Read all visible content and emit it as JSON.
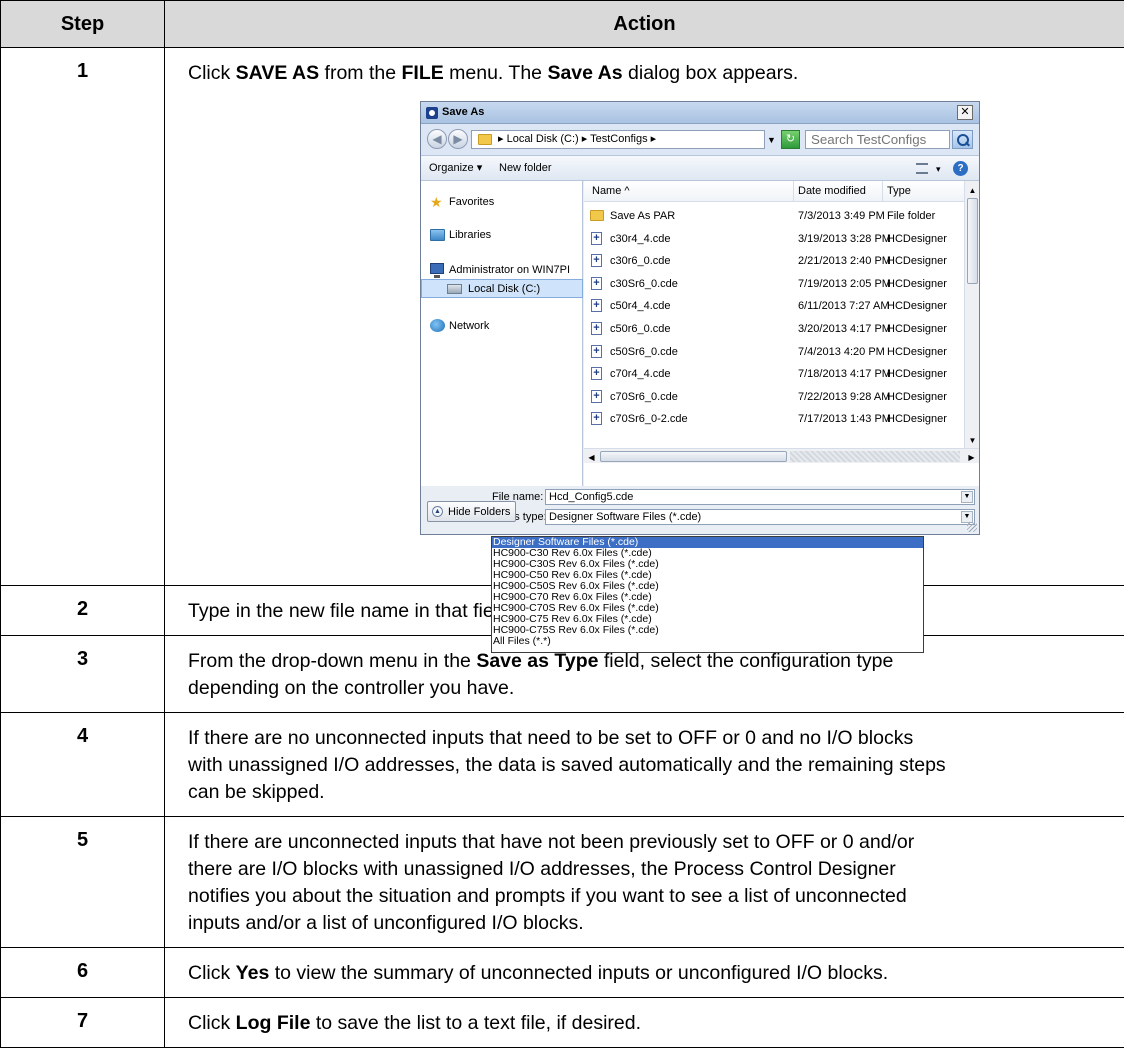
{
  "table": {
    "header_step": "Step",
    "header_action": "Action",
    "steps": [
      {
        "num": "1",
        "parts": [
          {
            "t": "Click "
          },
          {
            "t": "SAVE AS",
            "b": true
          },
          {
            "t": " from the "
          },
          {
            "t": "FILE",
            "b": true
          },
          {
            "t": " menu. The "
          },
          {
            "t": "Save As",
            "b": true
          },
          {
            "t": " dialog box appears."
          }
        ]
      },
      {
        "num": "2",
        "parts": [
          {
            "t": "Type in the new file name in that field."
          }
        ]
      },
      {
        "num": "3",
        "parts": [
          {
            "t": "From the drop-down menu in the "
          },
          {
            "t": "Save as Type",
            "b": true
          },
          {
            "t": " field, select the configuration type"
          },
          {
            "br": true
          },
          {
            "t": "depending on the controller you have."
          }
        ]
      },
      {
        "num": "4",
        "parts": [
          {
            "t": "If there are no unconnected inputs that need to be set to OFF or 0 and no I/O blocks"
          },
          {
            "br": true
          },
          {
            "t": "with unassigned I/O addresses, the data is saved automatically and the remaining steps"
          },
          {
            "br": true
          },
          {
            "t": "can be skipped."
          }
        ]
      },
      {
        "num": "5",
        "parts": [
          {
            "t": "If there are unconnected inputs that have not been previously set to OFF or 0 and/or"
          },
          {
            "br": true
          },
          {
            "t": "there are I/O blocks with unassigned I/O addresses, the Process Control Designer"
          },
          {
            "br": true
          },
          {
            "t": "notifies you about the situation and prompts if you want to see a list of unconnected"
          },
          {
            "br": true
          },
          {
            "t": "inputs and/or a list of unconfigured I/O blocks."
          }
        ]
      },
      {
        "num": "6",
        "parts": [
          {
            "t": "Click "
          },
          {
            "t": "Yes",
            "b": true
          },
          {
            "t": " to view the summary of unconnected inputs or unconfigured I/O blocks."
          }
        ]
      },
      {
        "num": "7",
        "parts": [
          {
            "t": "Click "
          },
          {
            "t": "Log File",
            "b": true
          },
          {
            "t": " to save the list to a text file, if desired."
          }
        ]
      }
    ]
  },
  "dialog": {
    "title": "Save As",
    "close_glyph": "✕",
    "back_glyph": "◀",
    "forward_glyph": "▶",
    "address_path": "▸ Local Disk (C:) ▸ TestConfigs ▸",
    "address_dropdown_glyph": "▼",
    "refresh_glyph": "↻",
    "search_placeholder": "Search TestConfigs",
    "organize_label": "Organize ▾",
    "new_folder_label": "New folder",
    "view_dropdown_glyph": "▾",
    "help_glyph": "?",
    "nav_items": [
      {
        "label": "Favorites",
        "icon": "star-icon"
      },
      {
        "label": "Libraries",
        "icon": "libraries-icon"
      },
      {
        "label": "Administrator on WIN7PI",
        "icon": "computer-icon"
      },
      {
        "label": "Local Disk (C:)",
        "icon": "local-disk-icon"
      },
      {
        "label": "Network",
        "icon": "network-icon"
      }
    ],
    "columns": {
      "name": "Name ^",
      "date": "Date modified",
      "type": "Type"
    },
    "files": [
      {
        "name": "Save As PAR",
        "date": "7/3/2013 3:49 PM",
        "type": "File folder",
        "icon": "folder-icon"
      },
      {
        "name": "c30r4_4.cde",
        "date": "3/19/2013 3:28 PM",
        "type": "HCDesigner",
        "icon": "cde-file-icon"
      },
      {
        "name": "c30r6_0.cde",
        "date": "2/21/2013 2:40 PM",
        "type": "HCDesigner",
        "icon": "cde-file-icon"
      },
      {
        "name": "c30Sr6_0.cde",
        "date": "7/19/2013 2:05 PM",
        "type": "HCDesigner",
        "icon": "cde-file-icon"
      },
      {
        "name": "c50r4_4.cde",
        "date": "6/11/2013 7:27 AM",
        "type": "HCDesigner",
        "icon": "cde-file-icon"
      },
      {
        "name": "c50r6_0.cde",
        "date": "3/20/2013 4:17 PM",
        "type": "HCDesigner",
        "icon": "cde-file-icon"
      },
      {
        "name": "c50Sr6_0.cde",
        "date": "7/4/2013 4:20 PM",
        "type": "HCDesigner",
        "icon": "cde-file-icon"
      },
      {
        "name": "c70r4_4.cde",
        "date": "7/18/2013 4:17 PM",
        "type": "HCDesigner",
        "icon": "cde-file-icon"
      },
      {
        "name": "c70Sr6_0.cde",
        "date": "7/22/2013 9:28 AM",
        "type": "HCDesigner",
        "icon": "cde-file-icon"
      },
      {
        "name": "c70Sr6_0-2.cde",
        "date": "7/17/2013 1:43 PM",
        "type": "HCDesigner",
        "icon": "cde-file-icon"
      }
    ],
    "file_name_label": "File name:",
    "file_name_value": "Hcd_Config5.cde",
    "save_type_label": "Save as type:",
    "save_type_value": "Designer Software Files (*.cde)",
    "hide_folders_label": "Hide Folders",
    "type_options": [
      "Designer Software Files (*.cde)",
      "HC900-C30 Rev 6.0x Files (*.cde)",
      "HC900-C30S Rev 6.0x Files (*.cde)",
      "HC900-C50 Rev 6.0x Files (*.cde)",
      "HC900-C50S Rev 6.0x Files (*.cde)",
      "HC900-C70 Rev 6.0x Files (*.cde)",
      "HC900-C70S Rev 6.0x Files (*.cde)",
      "HC900-C75 Rev 6.0x Files (*.cde)",
      "HC900-C75S Rev 6.0x Files (*.cde)",
      "All Files (*.*)"
    ],
    "selected_option_index": 0
  }
}
